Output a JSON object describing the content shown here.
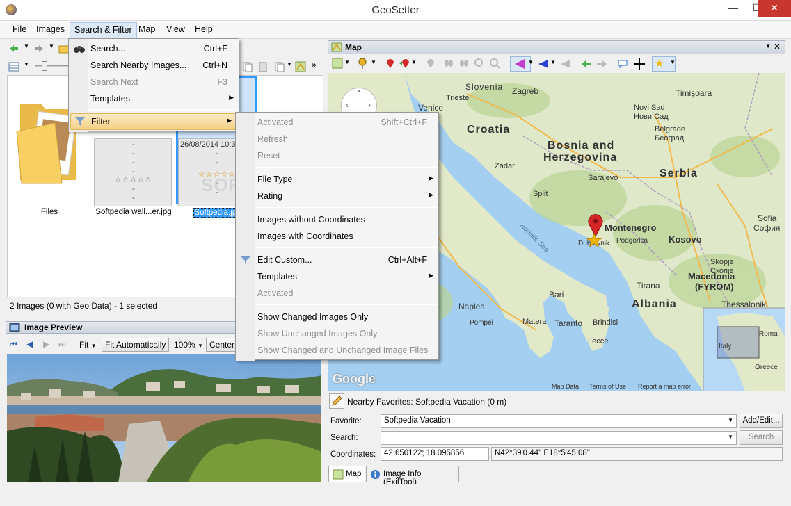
{
  "window": {
    "title": "GeoSetter",
    "minimize": "—",
    "maximize": "☐",
    "close": "✕"
  },
  "menubar": [
    "File",
    "Images",
    "Search & Filter",
    "Map",
    "View",
    "Help"
  ],
  "search_menu": {
    "items": [
      {
        "label": "Search...",
        "shortcut": "Ctrl+F",
        "disabled": false
      },
      {
        "label": "Search Nearby Images...",
        "shortcut": "Ctrl+N",
        "disabled": false
      },
      {
        "label": "Search Next",
        "shortcut": "F3",
        "disabled": true
      },
      {
        "label": "Templates",
        "shortcut": "",
        "disabled": false
      },
      {
        "label": "Filter",
        "shortcut": "",
        "disabled": false
      }
    ]
  },
  "filter_menu": {
    "items": [
      {
        "label": "Activated",
        "shortcut": "Shift+Ctrl+F",
        "disabled": true
      },
      {
        "label": "Refresh",
        "shortcut": "",
        "disabled": true
      },
      {
        "label": "Reset",
        "shortcut": "",
        "disabled": true
      },
      {
        "label": "File Type",
        "shortcut": "",
        "disabled": false
      },
      {
        "label": "Rating",
        "shortcut": "",
        "disabled": false
      },
      {
        "label": "Images without Coordinates",
        "shortcut": "",
        "disabled": false
      },
      {
        "label": "Images with Coordinates",
        "shortcut": "",
        "disabled": false
      },
      {
        "label": "Edit Custom...",
        "shortcut": "Ctrl+Alt+F",
        "disabled": false
      },
      {
        "label": "Templates",
        "shortcut": "",
        "disabled": false
      },
      {
        "label": "Activated",
        "shortcut": "",
        "disabled": true
      },
      {
        "label": "Show Changed Images Only",
        "shortcut": "",
        "disabled": false
      },
      {
        "label": "Show Unchanged Images Only",
        "shortcut": "",
        "disabled": true
      },
      {
        "label": "Show Changed and Unchanged Image Files",
        "shortcut": "",
        "disabled": true
      }
    ]
  },
  "browser": {
    "folder_label": "Files",
    "thumb1": {
      "label": "Softpedia wall...er.jpg",
      "line1": "-",
      "line2": "-",
      "line3": "-",
      "line4": "-",
      "stars": "☆☆☆☆☆",
      "line5": "-",
      "line6": "-"
    },
    "thumb2": {
      "label": "Softpedia.jpg",
      "date": "26/08/2014 10:3",
      "line2": "-",
      "line3": "-",
      "stars": "☆☆☆☆☆",
      "line5": "-",
      "line6": "-"
    },
    "status": "2 Images (0 with Geo Data) - 1 selected",
    "watermark": "SOFTPEDIA®"
  },
  "preview": {
    "title": "Image Preview",
    "fit": "Fit",
    "fit_auto": "Fit Automatically",
    "zoom": "100%",
    "center": "Center"
  },
  "map": {
    "title": "Map",
    "labels": {
      "slovenia": "Slovenia",
      "zagreb": "Zagreb",
      "timisoara": "Timișoara",
      "trieste": "Trieste",
      "venice": "Venice",
      "novi_sad": "Novi Sad",
      "novi_sad_cyr": "Нови Сад",
      "croatia": "Croatia",
      "belgrade": "Belgrade",
      "beograd": "Београд",
      "bosnia": "Bosnia and",
      "herzegovina": "Herzegovina",
      "zadar": "Zadar",
      "serbia": "Serbia",
      "sarajevo": "Sarajevo",
      "split": "Split",
      "adriatic": "Adriatic Sea",
      "montenegro": "Montenegro",
      "sofia": "Sofia",
      "sofia_cyr": "София",
      "dubrovnik": "Dubrovnik",
      "podgorica": "Podgorica",
      "kosovo": "Kosovo",
      "skopje": "Skopje",
      "skopje_cyr": "Скопје",
      "bari": "Bari",
      "tirana": "Tirana",
      "macedonia": "Macedonia",
      "fyrom": "(FYROM)",
      "albania": "Albania",
      "thessaloniki": "Thessaloniki",
      "naples": "Naples",
      "pompei": "Pompei",
      "matera": "Matera",
      "taranto": "Taranto",
      "brindisi": "Brindisi",
      "lecce": "Lecce",
      "italy": "Italy",
      "greece": "Greece",
      "romania": "Roma"
    },
    "google": "Google",
    "attribution": {
      "data": "Map Data",
      "terms": "Terms of Use",
      "report": "Report a map error"
    }
  },
  "nearby": {
    "text": "Nearby Favorites: Softpedia Vacation (0 m)"
  },
  "form": {
    "favorite_label": "Favorite:",
    "favorite_value": "Softpedia Vacation",
    "add_edit": "Add/Edit...",
    "search_label": "Search:",
    "search_value": "",
    "search_button": "Search",
    "coordinates_label": "Coordinates:",
    "coord_decimal": "42.650122; 18.095856",
    "coord_dms": "N42°39'0.44\" E18°5'45.08\""
  },
  "tabs": [
    "Map",
    "Image Info (ExifTool)"
  ],
  "colors": {
    "accent": "#f6d086",
    "marker": "#d62728",
    "selection": "#3399ff"
  }
}
